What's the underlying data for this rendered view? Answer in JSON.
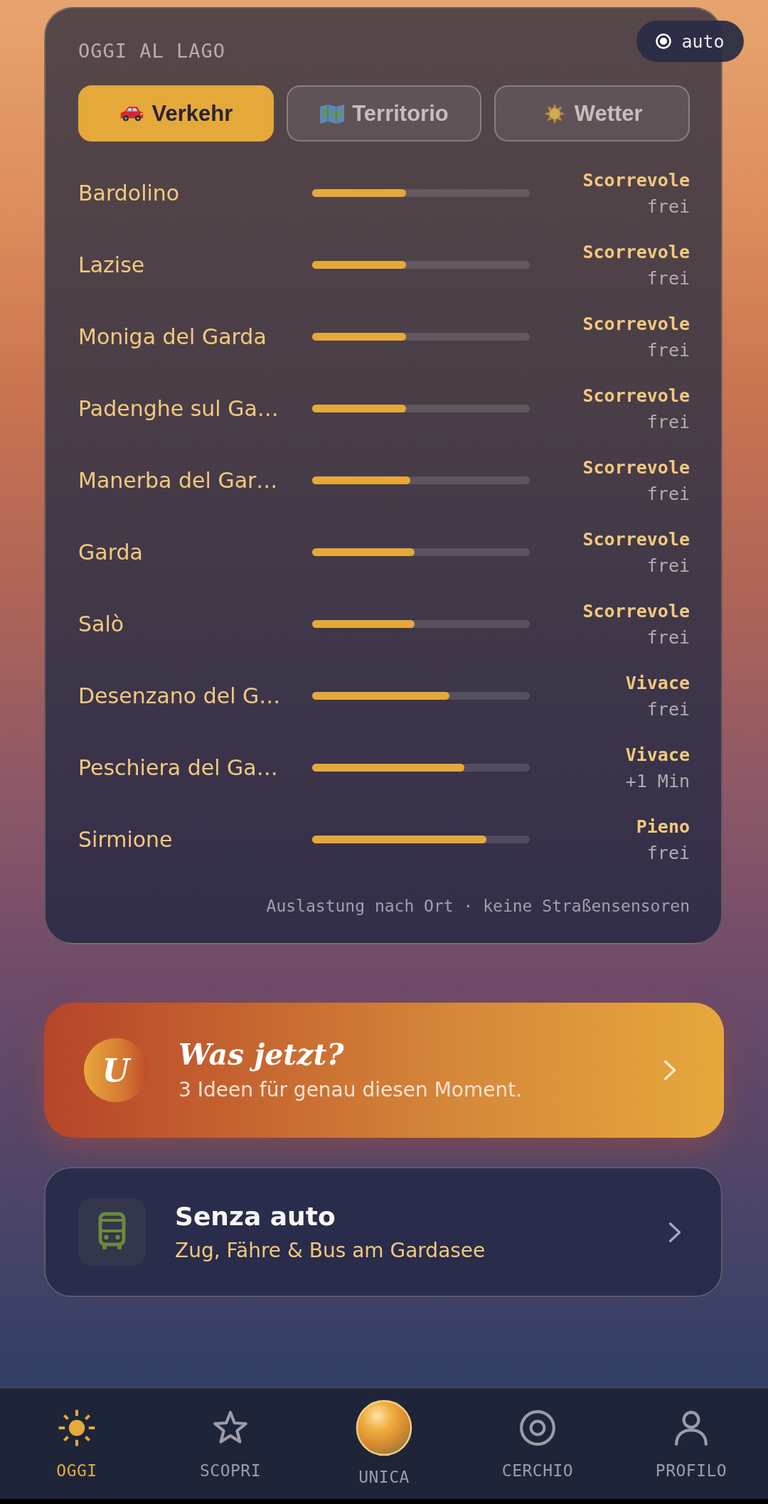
{
  "header": {
    "title": "OGGI AL LAGO"
  },
  "mode_chip": {
    "label": "auto"
  },
  "tabs": [
    {
      "label": "Verkehr",
      "selected": true
    },
    {
      "label": "Territorio",
      "selected": false
    },
    {
      "label": "Wetter",
      "selected": false
    }
  ],
  "traffic": [
    {
      "place": "Bardolino",
      "level": 0.43,
      "status": "Scorrevole",
      "delay": "frei"
    },
    {
      "place": "Lazise",
      "level": 0.43,
      "status": "Scorrevole",
      "delay": "frei"
    },
    {
      "place": "Moniga del Garda",
      "level": 0.43,
      "status": "Scorrevole",
      "delay": "frei"
    },
    {
      "place": "Padenghe sul Ga…",
      "level": 0.43,
      "status": "Scorrevole",
      "delay": "frei"
    },
    {
      "place": "Manerba del Gar…",
      "level": 0.45,
      "status": "Scorrevole",
      "delay": "frei"
    },
    {
      "place": "Garda",
      "level": 0.47,
      "status": "Scorrevole",
      "delay": "frei"
    },
    {
      "place": "Salò",
      "level": 0.47,
      "status": "Scorrevole",
      "delay": "frei"
    },
    {
      "place": "Desenzano del G…",
      "level": 0.63,
      "status": "Vivace",
      "delay": "frei"
    },
    {
      "place": "Peschiera del Ga…",
      "level": 0.7,
      "status": "Vivace",
      "delay": "+1 Min"
    },
    {
      "place": "Sirmione",
      "level": 0.8,
      "status": "Pieno",
      "delay": "frei"
    }
  ],
  "footnote": "Auslastung nach Ort · keine Straßensensoren",
  "suggestion_card": {
    "logo_letter": "U",
    "title": "Was jetzt?",
    "subtitle": "3 Ideen für genau diesen Moment."
  },
  "transit_card": {
    "title": "Senza auto",
    "subtitle": "Zug, Fähre & Bus am Gardasee"
  },
  "nav": [
    {
      "label": "OGGI",
      "kind": "icon",
      "selected": true
    },
    {
      "label": "SCOPRI",
      "kind": "icon",
      "selected": false
    },
    {
      "label": "UNICA",
      "kind": "orb",
      "selected": false
    },
    {
      "label": "CERCHIO",
      "kind": "icon",
      "selected": false
    },
    {
      "label": "PROFILO",
      "kind": "icon",
      "selected": false
    }
  ]
}
